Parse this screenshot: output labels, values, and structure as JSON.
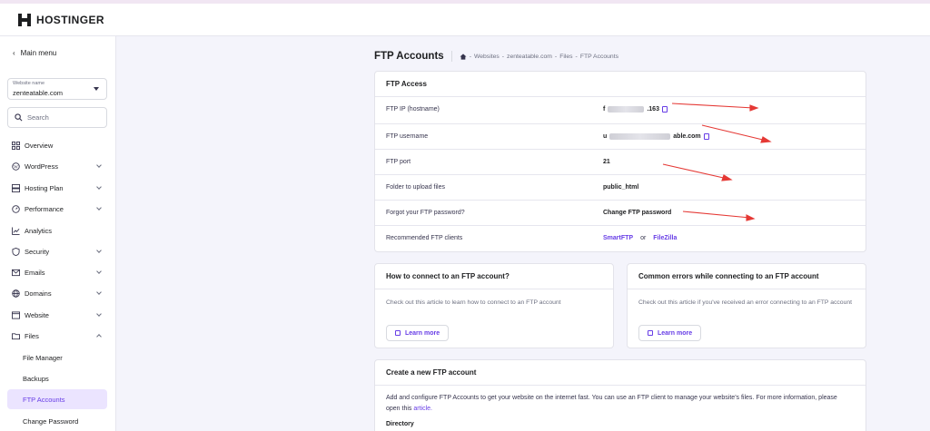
{
  "brand": "HOSTINGER",
  "sidebar": {
    "main_menu": "Main menu",
    "website_label": "Website name",
    "website_value": "zenteatable.com",
    "search_placeholder": "Search",
    "items": [
      {
        "label": "Overview",
        "icon": "grid-icon"
      },
      {
        "label": "WordPress",
        "icon": "wordpress-icon"
      },
      {
        "label": "Hosting Plan",
        "icon": "server-icon"
      },
      {
        "label": "Performance",
        "icon": "gauge-icon"
      },
      {
        "label": "Analytics",
        "icon": "chart-icon"
      },
      {
        "label": "Security",
        "icon": "shield-icon"
      },
      {
        "label": "Emails",
        "icon": "mail-icon"
      },
      {
        "label": "Domains",
        "icon": "globe-icon"
      },
      {
        "label": "Website",
        "icon": "browser-icon"
      },
      {
        "label": "Files",
        "icon": "folder-icon"
      }
    ],
    "files_sub": [
      "File Manager",
      "Backups",
      "FTP Accounts",
      "Change Password"
    ]
  },
  "page": {
    "title": "FTP Accounts",
    "breadcrumb": [
      "Websites",
      "zenteatable.com",
      "Files",
      "FTP Accounts"
    ]
  },
  "ftp_access": {
    "title": "FTP Access",
    "rows": [
      {
        "key": "FTP IP (hostname)",
        "value_suffix": ".163"
      },
      {
        "key": "FTP username",
        "value_suffix": "able.com"
      },
      {
        "key": "FTP port",
        "value": "21"
      },
      {
        "key": "Folder to upload files",
        "value": "public_html"
      },
      {
        "key": "Forgot your FTP password?",
        "value": "Change FTP password"
      },
      {
        "key": "Recommended FTP clients",
        "client1": "SmartFTP",
        "or": "or",
        "client2": "FileZilla"
      }
    ]
  },
  "connect_card": {
    "title": "How to connect to an FTP account?",
    "body": "Check out this article to learn how to connect to an FTP account",
    "button": "Learn more"
  },
  "errors_card": {
    "title": "Common errors while connecting to an FTP account",
    "body": "Check out this article if you've received an error connecting to an FTP account",
    "button": "Learn more"
  },
  "create_card": {
    "title": "Create a new FTP account",
    "body": "Add and configure FTP Accounts to get your website on the internet fast. You can use an FTP client to manage your website's files. For more information, please open this",
    "link": "article.",
    "directory_label": "Directory"
  },
  "colors": {
    "accent": "#673de6",
    "annotation": "#e53935",
    "background": "#f4f4fb"
  }
}
